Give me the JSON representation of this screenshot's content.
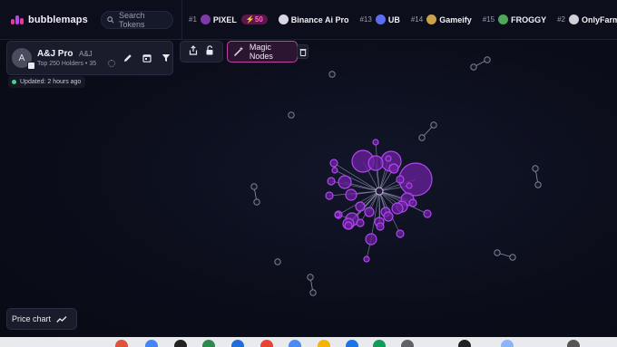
{
  "brand": {
    "name": "bubblemaps"
  },
  "search": {
    "placeholder": "Search Tokens"
  },
  "ticker": [
    {
      "rank": "#1",
      "name": "PIXEL",
      "boost": "50",
      "icon": "pixel-token-icon",
      "color": "#7e3aa8"
    },
    {
      "rank": "",
      "name": "Binance Ai Pro",
      "boost": "",
      "icon": "binance-ai-token-icon",
      "color": "#d8d8e2"
    },
    {
      "rank": "#13",
      "name": "UB",
      "boost": "",
      "icon": "ub-token-icon",
      "color": "#5b6ef0"
    },
    {
      "rank": "#14",
      "name": "Gameify",
      "boost": "",
      "icon": "gameify-token-icon",
      "color": "#c9a24a"
    },
    {
      "rank": "#15",
      "name": "FROGGY",
      "boost": "",
      "icon": "froggy-token-icon",
      "color": "#4fa85a"
    },
    {
      "rank": "#2",
      "name": "OnlyFarms",
      "boost": "",
      "icon": "onlyfarms-token-icon",
      "color": "#d0d0d8"
    }
  ],
  "map": {
    "avatar_letter": "A",
    "name": "A&J Pro",
    "symbol": "A&J",
    "subtitle": "Top 250 Holders • 35",
    "updated": "Updated: 2 hours ago"
  },
  "buttons": {
    "magic_nodes": "Magic Nodes",
    "price_chart": "Price chart"
  },
  "colors": {
    "accent": "#c042a8",
    "node_fill": "#6a1f9e",
    "node_stroke": "#b146f0",
    "link": "#8f8fb0",
    "isolated_node": "#7d8195",
    "background": "#0b0d1a"
  },
  "bubbles": {
    "hub": {
      "id": "hub"
    },
    "cluster": [
      {
        "id": "b1",
        "r": 12,
        "link": "hub"
      },
      {
        "id": "b2",
        "r": 11,
        "link": "hub"
      },
      {
        "id": "b3",
        "r": 18,
        "link": "hub"
      },
      {
        "id": "b4",
        "r": 8,
        "link": "hub"
      },
      {
        "id": "b5",
        "r": 7,
        "link": "hub"
      },
      {
        "id": "b6",
        "r": 7,
        "link": "hub"
      },
      {
        "id": "b7",
        "r": 6,
        "link": "hub"
      },
      {
        "id": "b8",
        "r": 6,
        "link": "hub"
      },
      {
        "id": "b9",
        "r": 7,
        "link": "hub"
      },
      {
        "id": "b10",
        "r": 6,
        "link": "hub"
      },
      {
        "id": "b11",
        "r": 5,
        "link": "hub"
      },
      {
        "id": "b12",
        "r": 5,
        "link": "hub"
      },
      {
        "id": "b13",
        "r": 6,
        "link": "hub"
      },
      {
        "id": "b14",
        "r": 5,
        "link": "hub"
      },
      {
        "id": "b15",
        "r": 5,
        "link": "hub"
      },
      {
        "id": "b16",
        "r": 6,
        "link": "hub"
      },
      {
        "id": "b17",
        "r": 5,
        "link": "hub"
      },
      {
        "id": "b18",
        "r": 5,
        "link": "hub"
      },
      {
        "id": "b19",
        "r": 4,
        "link": "hub"
      },
      {
        "id": "b20",
        "r": 4,
        "link": "hub"
      },
      {
        "id": "b21",
        "r": 4,
        "link": "hub"
      },
      {
        "id": "b22",
        "r": 4,
        "link": "hub"
      },
      {
        "id": "b23",
        "r": 4,
        "link": "hub"
      },
      {
        "id": "b24",
        "r": 4,
        "link": "hub"
      },
      {
        "id": "b25",
        "r": 4,
        "link": "hub"
      },
      {
        "id": "b26",
        "r": 4,
        "link": "hub"
      },
      {
        "id": "b27",
        "r": 4,
        "link": "hub"
      },
      {
        "id": "b28",
        "r": 4,
        "link": "hub"
      },
      {
        "id": "b29",
        "r": 4,
        "link": "hub"
      },
      {
        "id": "b30",
        "r": 3,
        "link": "hub"
      },
      {
        "id": "b31",
        "r": 3,
        "link": "hub"
      },
      {
        "id": "b32",
        "r": 3,
        "link": "hub"
      },
      {
        "id": "b33",
        "r": 3,
        "link": "hub"
      },
      {
        "id": "b34",
        "r": 3,
        "link": "b9"
      },
      {
        "id": "b35",
        "r": 3,
        "link": "b16"
      }
    ],
    "isolated_count": 10,
    "isolated_pairs": 6
  }
}
